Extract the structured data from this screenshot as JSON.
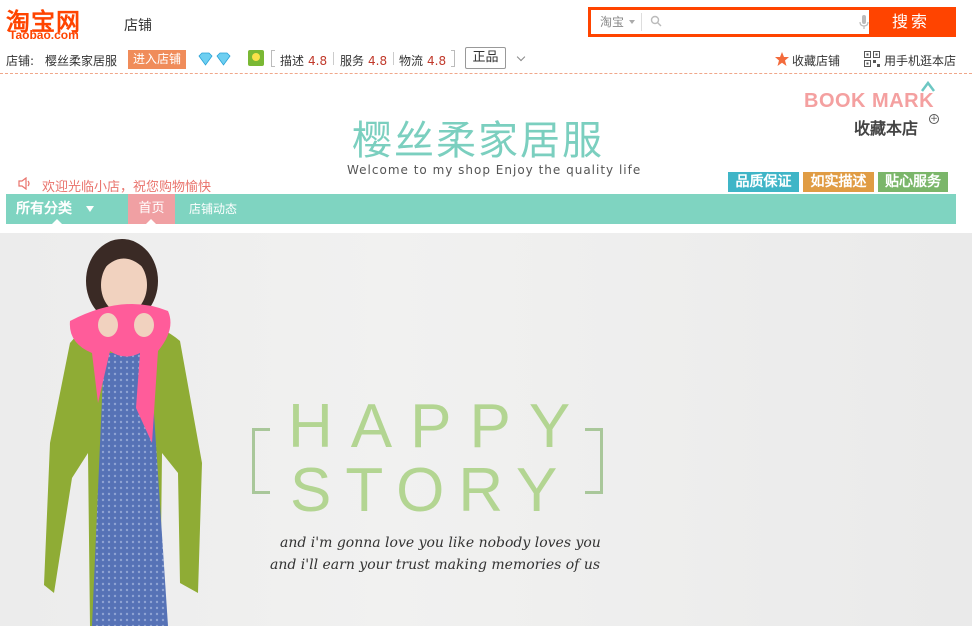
{
  "header": {
    "logo_cn": "淘宝网",
    "logo_en": "Taobao.com",
    "shop_word": "店铺",
    "search": {
      "scope": "淘宝",
      "placeholder": "",
      "button": "搜索"
    }
  },
  "infobar": {
    "shop_label": "店铺:",
    "shop_name": "樱丝柔家居服",
    "enter_button": "进入店铺",
    "ratings": [
      {
        "label": "描述",
        "score": "4.8"
      },
      {
        "label": "服务",
        "score": "4.8"
      },
      {
        "label": "物流",
        "score": "4.8"
      }
    ],
    "genuine_badge": "正品",
    "favorite": "收藏店铺",
    "mobile": "用手机逛本店"
  },
  "banner": {
    "bookmark_en": "BOOK MARK",
    "bookmark_cn": "收藏本店",
    "title": "樱丝柔家居服",
    "subtitle": "Welcome to my shop Enjoy the quality life",
    "welcome": "欢迎光临小店，祝您购物愉快",
    "badges": [
      {
        "label": "品质保证",
        "color": "#3fb5c7"
      },
      {
        "label": "如实描述",
        "color": "#e09c44"
      },
      {
        "label": "贴心服务",
        "color": "#7bb66a"
      }
    ]
  },
  "nav": {
    "all_categories": "所有分类",
    "home": "首页",
    "news": "店铺动态"
  },
  "hero": {
    "word1": "HAPPY",
    "word2": "STORY",
    "lyric1": "and i'm gonna love you like nobody loves you",
    "lyric2": "and i'll earn your trust making memories of us"
  },
  "colors": {
    "brand_orange": "#ff4400",
    "teal": "#7fd4c1",
    "pink": "#f0a0a3"
  }
}
